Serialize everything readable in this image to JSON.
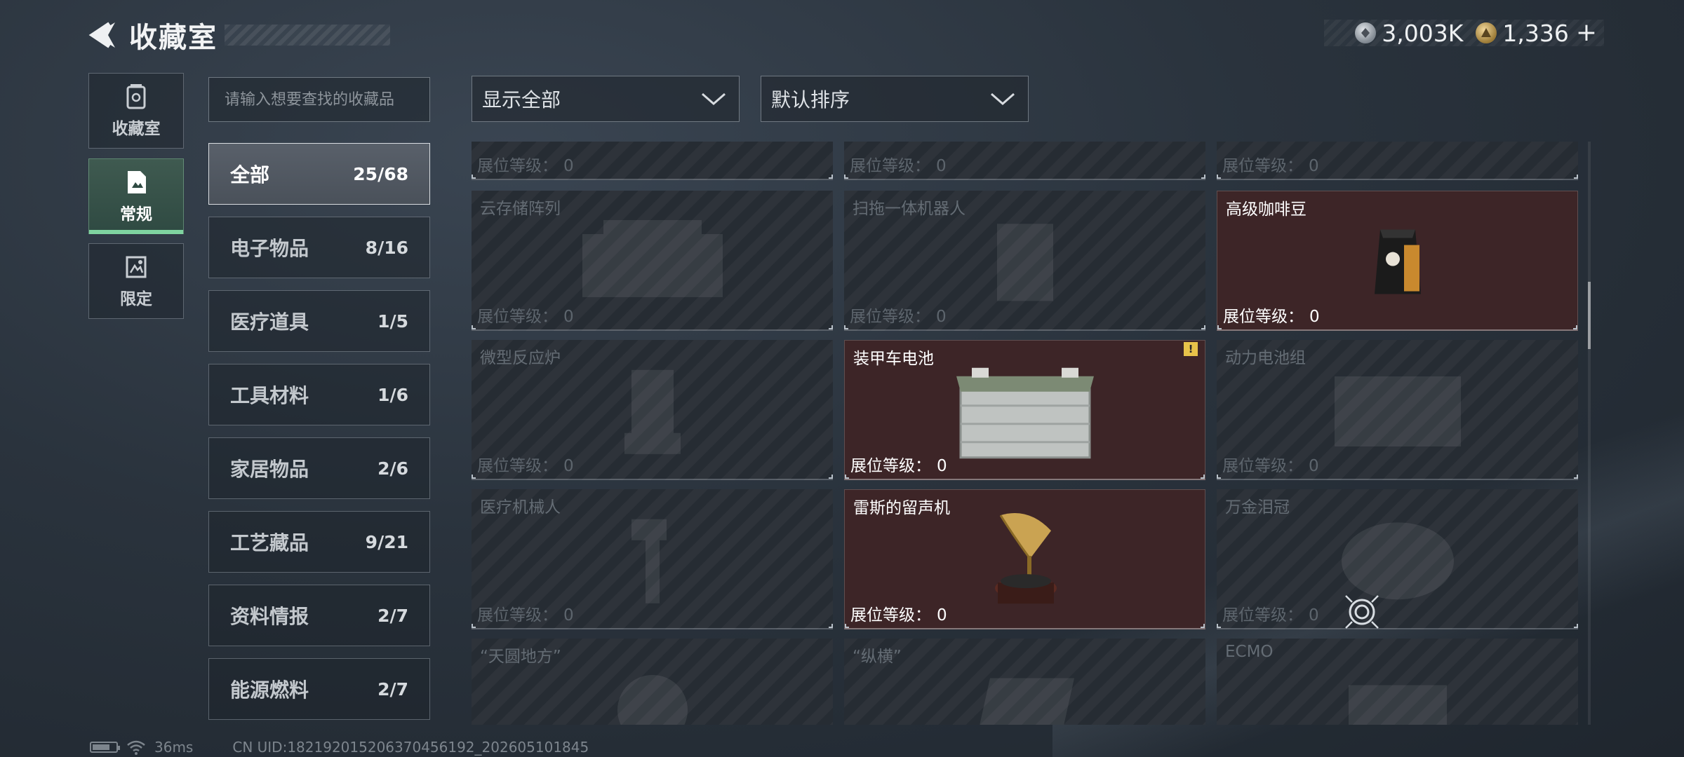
{
  "header": {
    "title": "收藏室",
    "back_icon": "back-arrow-icon"
  },
  "currency": {
    "silver": {
      "icon": "silver-coin-icon",
      "value": "3,003K"
    },
    "gold": {
      "icon": "gold-coin-icon",
      "value": "1,336"
    },
    "plus_label": "+"
  },
  "side_tabs": [
    {
      "label": "收藏室",
      "icon": "vault-icon",
      "active": false
    },
    {
      "label": "常规",
      "icon": "document-icon",
      "active": true
    },
    {
      "label": "限定",
      "icon": "limited-icon",
      "active": false
    }
  ],
  "search": {
    "placeholder": "请输入想要查找的收藏品",
    "value": ""
  },
  "categories": [
    {
      "label": "全部",
      "count": "25/68",
      "active": true
    },
    {
      "label": "电子物品",
      "count": "8/16",
      "active": false
    },
    {
      "label": "医疗道具",
      "count": "1/5",
      "active": false
    },
    {
      "label": "工具材料",
      "count": "1/6",
      "active": false
    },
    {
      "label": "家居物品",
      "count": "2/6",
      "active": false
    },
    {
      "label": "工艺藏品",
      "count": "9/21",
      "active": false
    },
    {
      "label": "资料情报",
      "count": "2/7",
      "active": false
    },
    {
      "label": "能源燃料",
      "count": "2/7",
      "active": false
    }
  ],
  "filters": {
    "display": "显示全部",
    "sort": "默认排序"
  },
  "level_label": "展位等级：",
  "cards": [
    {
      "name": "",
      "level": "0",
      "owned": false
    },
    {
      "name": "",
      "level": "0",
      "owned": false
    },
    {
      "name": "",
      "level": "0",
      "owned": false
    },
    {
      "name": "云存储阵列",
      "level": "0",
      "owned": false
    },
    {
      "name": "扫拖一体机器人",
      "level": "0",
      "owned": false
    },
    {
      "name": "高级咖啡豆",
      "level": "0",
      "owned": true
    },
    {
      "name": "微型反应炉",
      "level": "0",
      "owned": false
    },
    {
      "name": "装甲车电池",
      "level": "0",
      "owned": true,
      "warning": true
    },
    {
      "name": "动力电池组",
      "level": "0",
      "owned": false
    },
    {
      "name": "医疗机械人",
      "level": "0",
      "owned": false
    },
    {
      "name": "雷斯的留声机",
      "level": "0",
      "owned": true
    },
    {
      "name": "万金泪冠",
      "level": "0",
      "owned": false
    },
    {
      "name": "“天圆地方”",
      "level": "",
      "owned": false
    },
    {
      "name": "“纵横”",
      "level": "",
      "owned": false
    },
    {
      "name": "ECMO",
      "level": "",
      "owned": false
    }
  ],
  "warning_mark": "!",
  "footer": {
    "ping": "36ms",
    "uid": "CN UID:18219201520637045619​2_202605101845"
  }
}
